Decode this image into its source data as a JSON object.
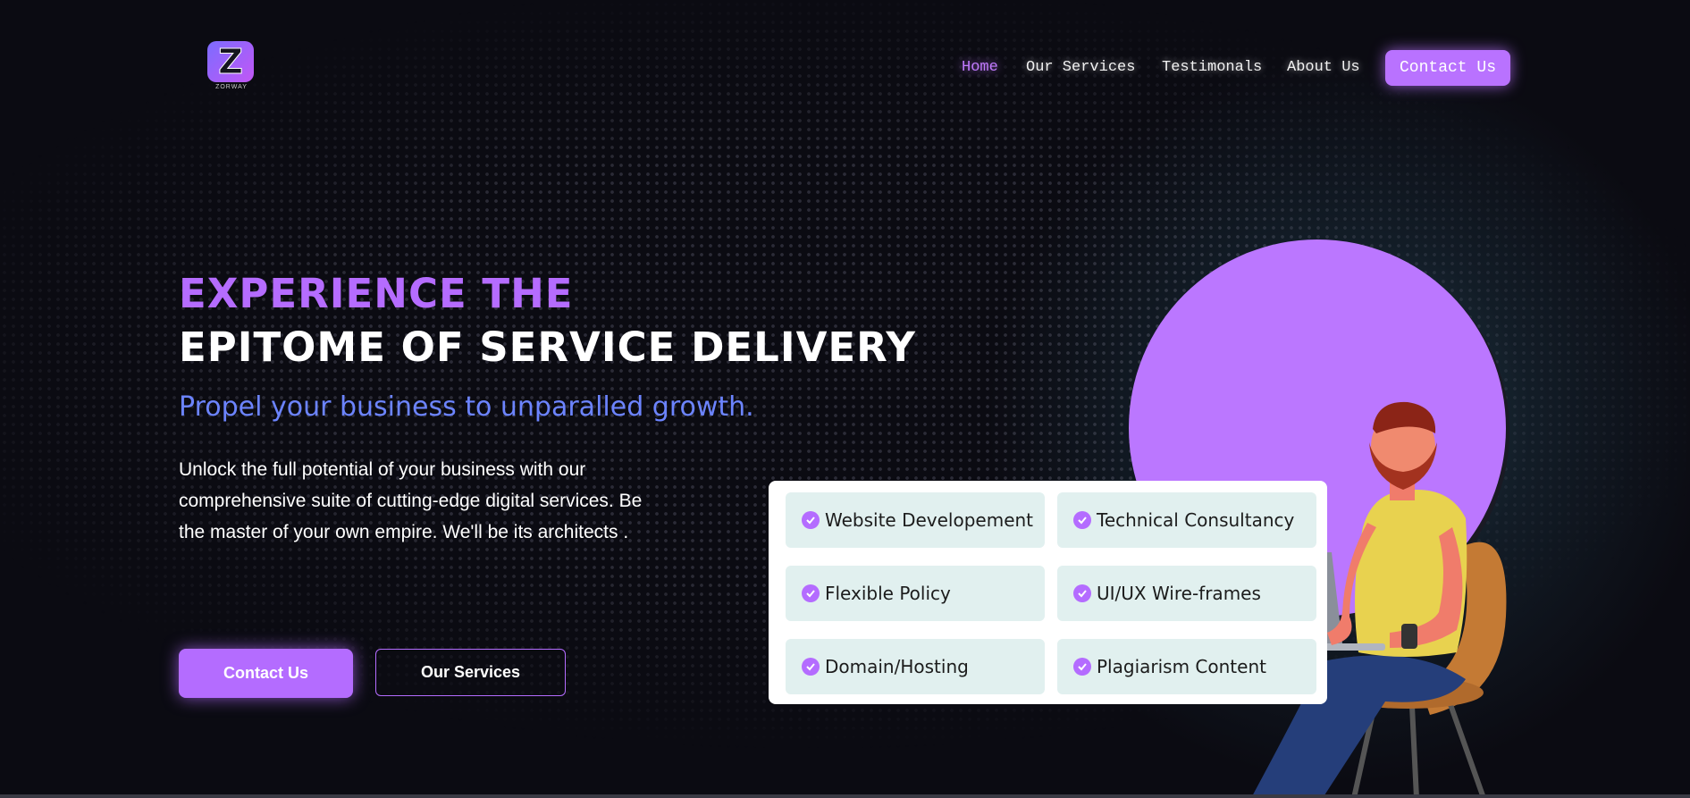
{
  "brand": {
    "logo_letter": "Z",
    "logo_text": "ZORWAY",
    "accent": "#b46cff",
    "tagline_color": "#6c84ff"
  },
  "nav": {
    "items": [
      {
        "label": "Home",
        "active": true
      },
      {
        "label": "Our Services",
        "active": false
      },
      {
        "label": "Testimonals",
        "active": false
      },
      {
        "label": "About Us",
        "active": false
      }
    ],
    "cta_label": "Contact Us"
  },
  "hero": {
    "heading_line1": "EXPERIENCE THE",
    "heading_line2": "EPITOME OF SERVICE DELIVERY",
    "tagline": "Propel your business to unparalled growth.",
    "description": "Unlock the full potential of your business with our comprehensive suite of cutting-edge digital services. Be the master of your own empire. We'll be its architects .",
    "primary_button": "Contact Us",
    "secondary_button": "Our Services"
  },
  "services": {
    "check_icon": "check-circle-icon",
    "items": [
      "Website Developement",
      "Technical Consultancy",
      "Flexible Policy",
      "UI/UX Wire-frames",
      "Domain/Hosting",
      "Plagiarism Content"
    ]
  }
}
